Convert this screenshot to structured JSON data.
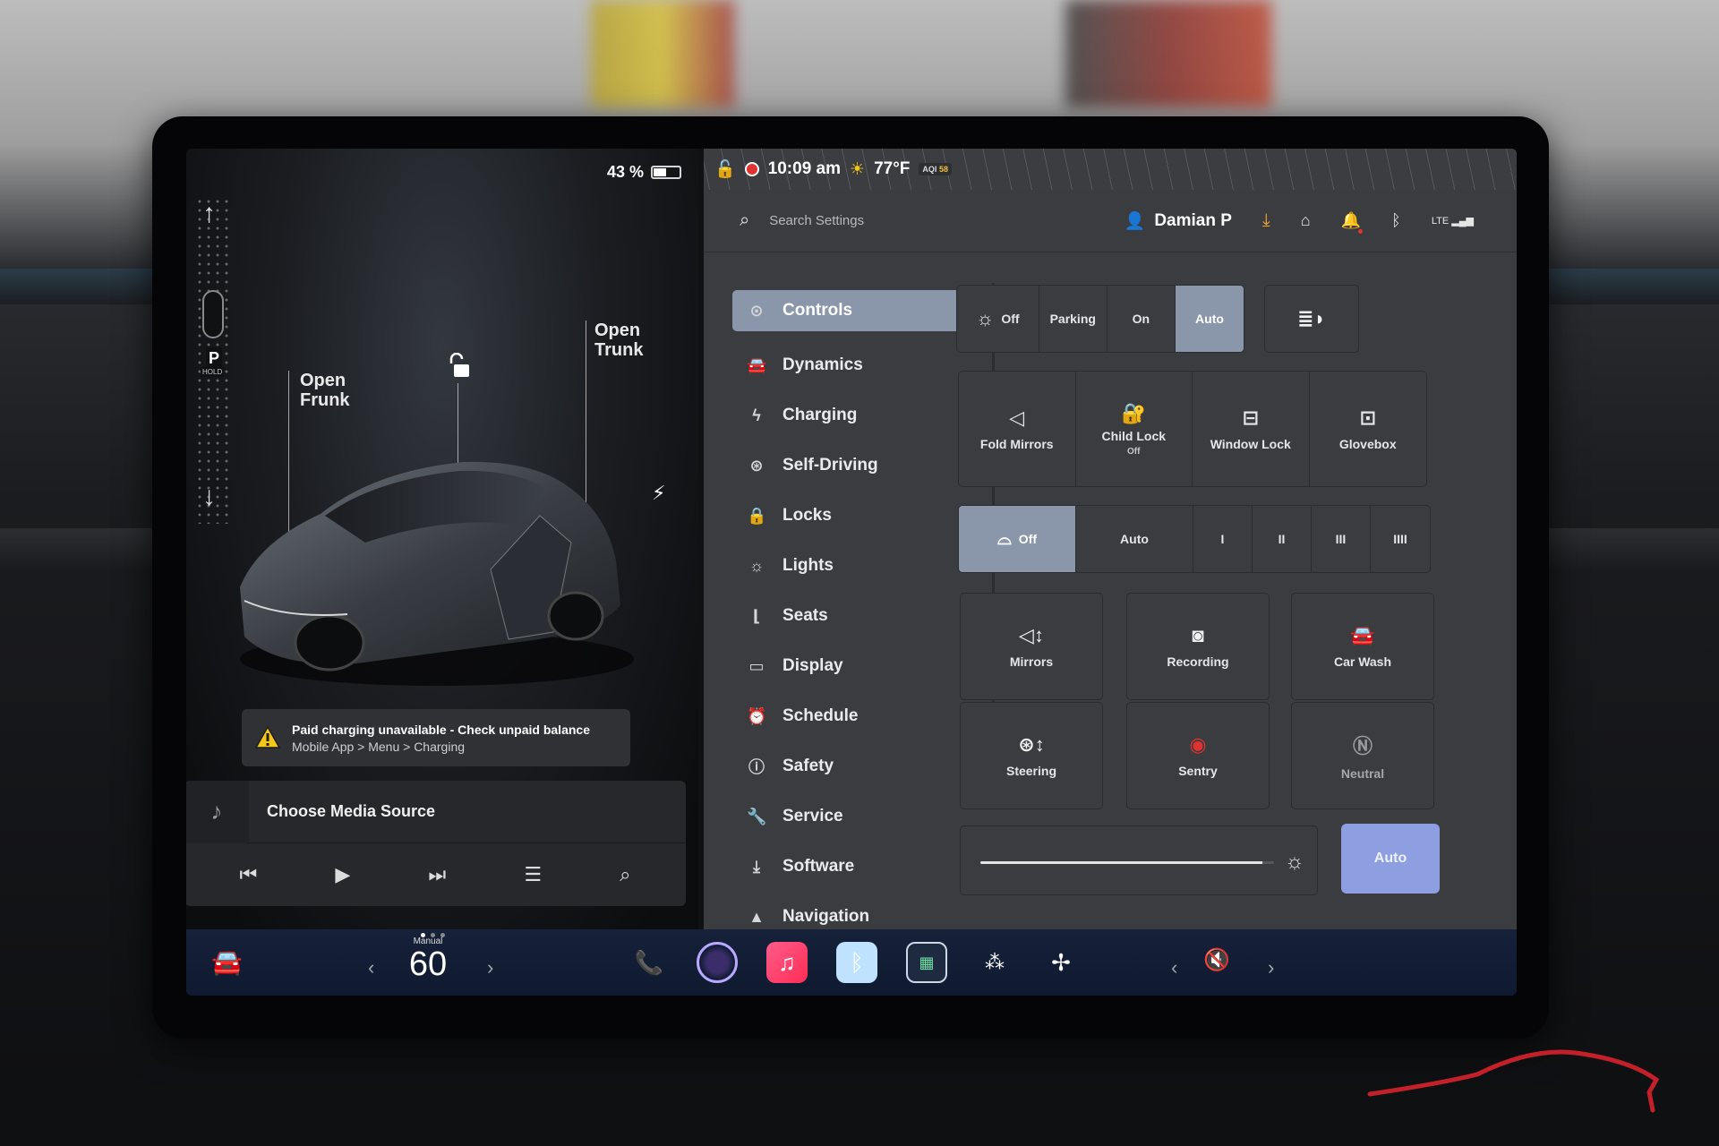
{
  "left_panel": {
    "battery_percent": "43 %",
    "gear": {
      "letter": "P",
      "hold": "HOLD"
    },
    "callouts": {
      "frunk": [
        "Open",
        "Frunk"
      ],
      "trunk": [
        "Open",
        "Trunk"
      ]
    },
    "alert": {
      "line1": "Paid charging unavailable - Check unpaid balance",
      "line2": "Mobile App > Menu > Charging"
    },
    "media": {
      "source_label": "Choose Media Source"
    }
  },
  "status_bar": {
    "time": "10:09 am",
    "temperature": "77°F",
    "aqi_label": "AQI",
    "aqi_value": "58"
  },
  "top_bar": {
    "search_placeholder": "Search Settings",
    "user_name": "Damian P",
    "signal_label": "LTE"
  },
  "nav": {
    "items": [
      {
        "label": "Controls",
        "icon": "toggle-icon",
        "active": true
      },
      {
        "label": "Dynamics",
        "icon": "car-icon"
      },
      {
        "label": "Charging",
        "icon": "bolt-icon"
      },
      {
        "label": "Self-Driving",
        "icon": "steering-wheel-icon"
      },
      {
        "label": "Locks",
        "icon": "lock-icon"
      },
      {
        "label": "Lights",
        "icon": "sun-icon"
      },
      {
        "label": "Seats",
        "icon": "seat-icon"
      },
      {
        "label": "Display",
        "icon": "display-icon"
      },
      {
        "label": "Schedule",
        "icon": "alarm-clock-icon"
      },
      {
        "label": "Safety",
        "icon": "info-circle-icon"
      },
      {
        "label": "Service",
        "icon": "wrench-icon"
      },
      {
        "label": "Software",
        "icon": "download-icon"
      },
      {
        "label": "Navigation",
        "icon": "navigation-arrow-icon"
      }
    ]
  },
  "controls": {
    "lights": {
      "options": [
        "Off",
        "Parking",
        "On",
        "Auto"
      ],
      "selected": "Auto"
    },
    "quick_tiles": [
      {
        "label": "Fold Mirrors"
      },
      {
        "label": "Child Lock",
        "sub": "Off"
      },
      {
        "label": "Window Lock"
      },
      {
        "label": "Glovebox"
      }
    ],
    "wipers": {
      "options": [
        "Off",
        "Auto",
        "I",
        "II",
        "III",
        "IIII"
      ],
      "selected": "Off"
    },
    "grid_tiles": [
      "Mirrors",
      "Recording",
      "Car Wash",
      "Steering",
      "Sentry",
      "Neutral"
    ],
    "brightness": {
      "level": 0.96,
      "auto_label": "Auto"
    }
  },
  "dock": {
    "speed_mode": "Manual",
    "speed_value": "60",
    "volume_state": "muted"
  },
  "colors": {
    "accent": "#8a96aa",
    "auto_button": "#8d9fe0",
    "alert": "#f5c518",
    "record": "#e0322f",
    "download": "#f5a623"
  }
}
